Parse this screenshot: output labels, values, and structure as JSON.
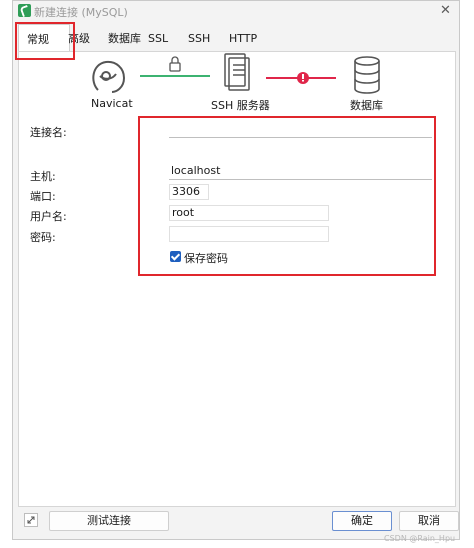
{
  "window": {
    "title": "新建连接 (MySQL)",
    "close_glyph": "✕"
  },
  "tabs": [
    {
      "label": "常规",
      "active": true
    },
    {
      "label": "高级",
      "active": false
    },
    {
      "label": "数据库",
      "active": false
    },
    {
      "label": "SSL",
      "active": false
    },
    {
      "label": "SSH",
      "active": false
    },
    {
      "label": "HTTP",
      "active": false
    }
  ],
  "diagram": {
    "navicat_label": "Navicat",
    "ssh_label": "SSH 服务器",
    "db_label": "数据库",
    "link_ok_color": "#3cb371",
    "link_error_color": "#e0264a",
    "icons": [
      "navicat-logo-icon",
      "lock-icon",
      "server-icon",
      "error-dot-icon",
      "database-icon"
    ]
  },
  "form": {
    "connection_name": {
      "label": "连接名:",
      "value": ""
    },
    "host": {
      "label": "主机:",
      "value": "localhost"
    },
    "port": {
      "label": "端口:",
      "value": "3306"
    },
    "username": {
      "label": "用户名:",
      "value": "root"
    },
    "password": {
      "label": "密码:",
      "value": ""
    },
    "save_password": {
      "label": "保存密码",
      "checked": true
    }
  },
  "footer": {
    "test_button": "测试连接",
    "ok_button": "确定",
    "cancel_button": "取消",
    "corner_icon": "expand-icon"
  },
  "watermark": "CSDN @Rain_Hpu",
  "accent_color": "#1f5fbf",
  "highlight_color": "#e0262c"
}
